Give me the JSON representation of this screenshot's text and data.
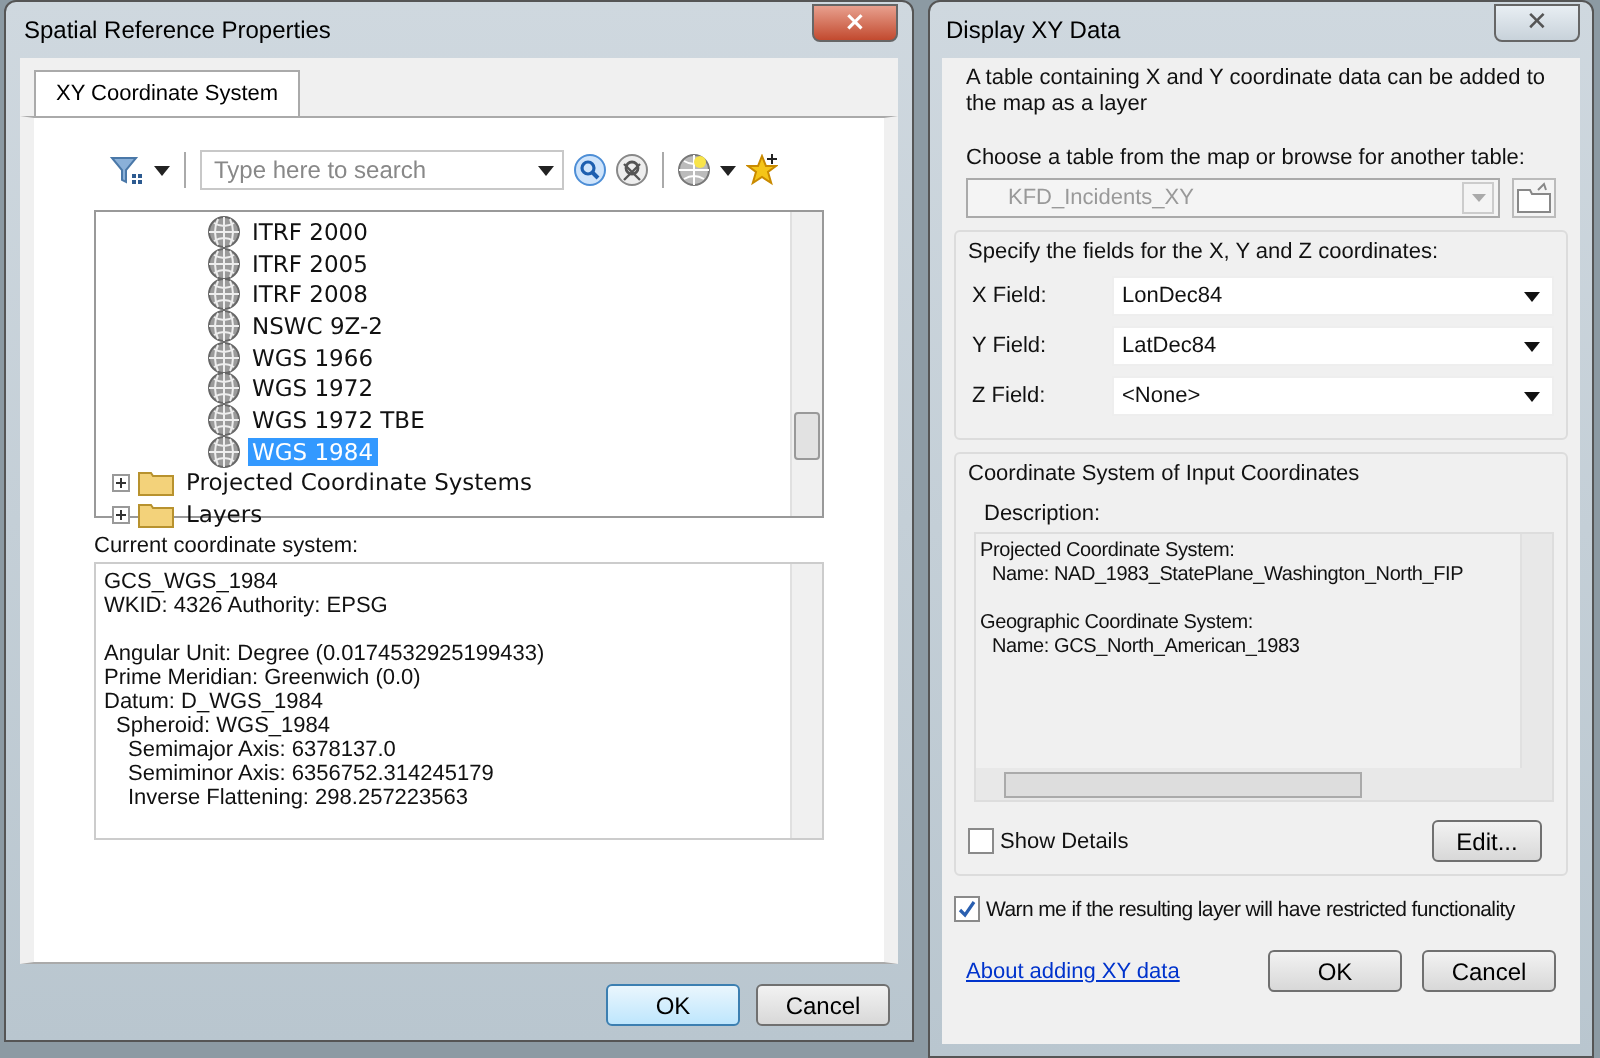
{
  "left_window": {
    "title": "Spatial Reference Properties",
    "close": "×",
    "tabs": [
      {
        "label": "XY Coordinate System",
        "selected": true
      }
    ],
    "search": {
      "placeholder": "Type here to search"
    },
    "tree": [
      {
        "label": "ITRF 2000",
        "kind": "system",
        "selected": false
      },
      {
        "label": "ITRF 2005",
        "kind": "system",
        "selected": false
      },
      {
        "label": "ITRF 2008",
        "kind": "system",
        "selected": false
      },
      {
        "label": "NSWC 9Z-2",
        "kind": "system",
        "selected": false
      },
      {
        "label": "WGS 1966",
        "kind": "system",
        "selected": false
      },
      {
        "label": "WGS 1972",
        "kind": "system",
        "selected": false
      },
      {
        "label": "WGS 1972 TBE",
        "kind": "system",
        "selected": false
      },
      {
        "label": "WGS 1984",
        "kind": "system",
        "selected": true
      },
      {
        "label": "Projected Coordinate Systems",
        "kind": "folder",
        "expanded": false,
        "selected": false
      },
      {
        "label": "Layers",
        "kind": "folder",
        "expanded": false,
        "selected": false
      }
    ],
    "current_label": "Current coordinate system:",
    "current_system": [
      {
        "lines": [
          {
            "text": "GCS_WGS_1984"
          },
          {
            "text": "WKID: 4326 Authority: EPSG"
          }
        ]
      },
      {
        "lines": [
          {
            "text": "Angular Unit: Degree (0.0174532925199433)"
          },
          {
            "text": "Prime Meridian: Greenwich (0.0)"
          },
          {
            "text": "Datum: D_WGS_1984",
            "children": [
              {
                "text": "Spheroid: WGS_1984",
                "children": [
                  {
                    "text": "Semimajor Axis: 6378137.0"
                  },
                  {
                    "text": "Semiminor Axis: 6356752.314245179"
                  },
                  {
                    "text": "Inverse Flattening: 298.257223563"
                  }
                ]
              }
            ]
          }
        ]
      }
    ],
    "buttons": [
      {
        "label": "OK",
        "default": true
      },
      {
        "label": "Cancel",
        "default": false
      }
    ]
  },
  "right_window": {
    "title": "Display XY Data",
    "close": "✕",
    "intro": "A table containing X and Y coordinate data can be added to the map as a layer",
    "table_label": "Choose a table from the map or browse for another table:",
    "table": {
      "value": "KFD_Incidents_XY",
      "disabled": true
    },
    "fields_group": "Specify the fields for the X, Y and Z coordinates:",
    "fields": [
      {
        "label": "X Field:",
        "value": "LonDec84"
      },
      {
        "label": "Y Field:",
        "value": "LatDec84"
      },
      {
        "label": "Z Field:",
        "value": "<None>"
      }
    ],
    "coord_group": "Coordinate System of Input Coordinates",
    "description_label": "Description:",
    "description": [
      {
        "lines": [
          {
            "text": "Projected Coordinate System:",
            "children": [
              {
                "text": "Name: NAD_1983_StatePlane_Washington_North_FIP"
              }
            ]
          }
        ]
      },
      {
        "lines": [
          {
            "text": "Geographic Coordinate System:",
            "children": [
              {
                "text": "Name: GCS_North_American_1983"
              }
            ]
          }
        ]
      }
    ],
    "show_details": {
      "label": "Show Details",
      "checked": false
    },
    "edit_button": "Edit...",
    "warn": {
      "label": "Warn me if the resulting layer will have restricted functionality",
      "checked": true
    },
    "link": "About adding XY data",
    "buttons": [
      {
        "label": "OK",
        "default": false
      },
      {
        "label": "Cancel",
        "default": false
      }
    ]
  }
}
